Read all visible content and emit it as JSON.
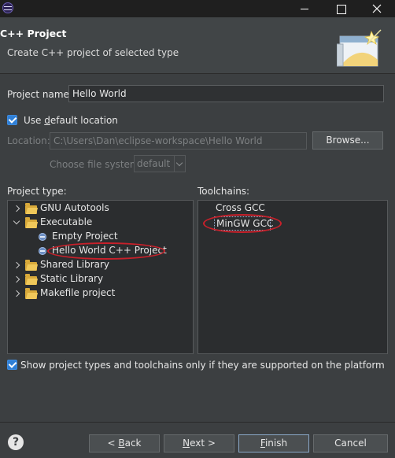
{
  "window": {
    "title": ""
  },
  "header": {
    "title": "C++ Project",
    "description": "Create C++ project of selected type"
  },
  "project_name": {
    "label": "Project name:",
    "value": "Hello World"
  },
  "default_location": {
    "label_pre": "Use ",
    "label_ul": "d",
    "label_post": "efault location",
    "checked": true
  },
  "location": {
    "label": "Location:",
    "value": "C:\\Users\\Dan\\eclipse-workspace\\Hello World",
    "browse_label": "Browse..."
  },
  "filesystem": {
    "label": "Choose file system:",
    "value": "default"
  },
  "project_type": {
    "label": "Project type:",
    "items": [
      {
        "label": "GNU Autotools",
        "kind": "folder",
        "expanded": false,
        "level": 0
      },
      {
        "label": "Executable",
        "kind": "folder",
        "expanded": true,
        "level": 0
      },
      {
        "label": "Empty Project",
        "kind": "project",
        "level": 1
      },
      {
        "label": "Hello World C++ Project",
        "kind": "project",
        "level": 1,
        "selected": true
      },
      {
        "label": "Shared Library",
        "kind": "folder",
        "expanded": false,
        "level": 0
      },
      {
        "label": "Static Library",
        "kind": "folder",
        "expanded": false,
        "level": 0
      },
      {
        "label": "Makefile project",
        "kind": "folder",
        "expanded": false,
        "level": 0
      }
    ]
  },
  "toolchains": {
    "label": "Toolchains:",
    "items": [
      {
        "label": "Cross GCC"
      },
      {
        "label": "MinGW GCC",
        "selected": true
      }
    ]
  },
  "show_supported": {
    "label": "Show project types and toolchains only if they are supported on the platform",
    "checked": true
  },
  "footer": {
    "help": "?",
    "back_ul": "B",
    "back_post": "ack",
    "next_ul": "N",
    "next_pre": "",
    "next_post": "ext",
    "finish_ul": "F",
    "finish_post": "inish",
    "cancel": "Cancel"
  },
  "colors": {
    "background": "#3c3f41",
    "header": "#414547",
    "accent_checkbox": "#2f7fd6",
    "annotation_red": "#c8202a"
  }
}
